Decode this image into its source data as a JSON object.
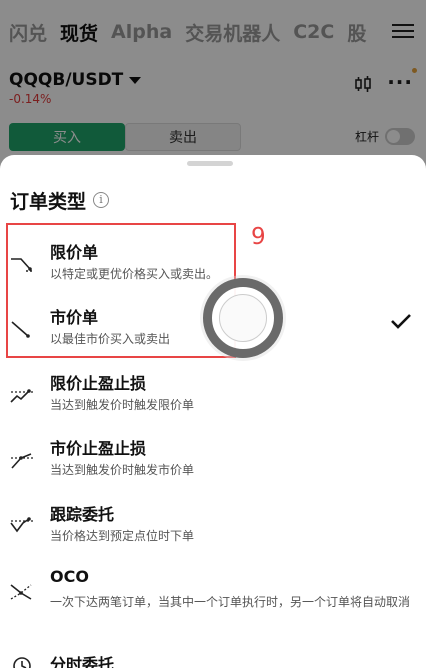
{
  "nav": {
    "tabs": [
      "闪兑",
      "现货",
      "Alpha",
      "交易机器人",
      "C2C",
      "股"
    ],
    "active_index": 1
  },
  "pair": {
    "name": "QQQB/USDT",
    "change": "-0.14%"
  },
  "trade": {
    "buy": "买入",
    "sell": "卖出",
    "leverage": "杠杆"
  },
  "sheet": {
    "title": "订单类型",
    "options": [
      {
        "title": "限价单",
        "desc": "以特定或更优价格买入或卖出。",
        "icon": "limit-order-icon"
      },
      {
        "title": "市价单",
        "desc": "以最佳市价买入或卖出",
        "icon": "market-order-icon",
        "selected": true
      },
      {
        "title": "限价止盈止损",
        "desc": "当达到触发价时触发限价单",
        "icon": "limit-tpsl-icon"
      },
      {
        "title": "市价止盈止损",
        "desc": "当达到触发价时触发市价单",
        "icon": "market-tpsl-icon"
      },
      {
        "title": "跟踪委托",
        "desc": "当价格达到预定点位时下单",
        "icon": "trailing-order-icon"
      },
      {
        "title": "OCO",
        "desc": "一次下达两笔订单，当其中一个订单执行时，另一个订单将自动取消",
        "icon": "oco-icon"
      },
      {
        "title": "分时委托",
        "desc": "",
        "icon": "twap-icon"
      }
    ]
  },
  "annotation": {
    "step": "9"
  },
  "colors": {
    "buy": "#1fa56a",
    "negative": "#e03a3a",
    "annotation": "#e84545"
  }
}
